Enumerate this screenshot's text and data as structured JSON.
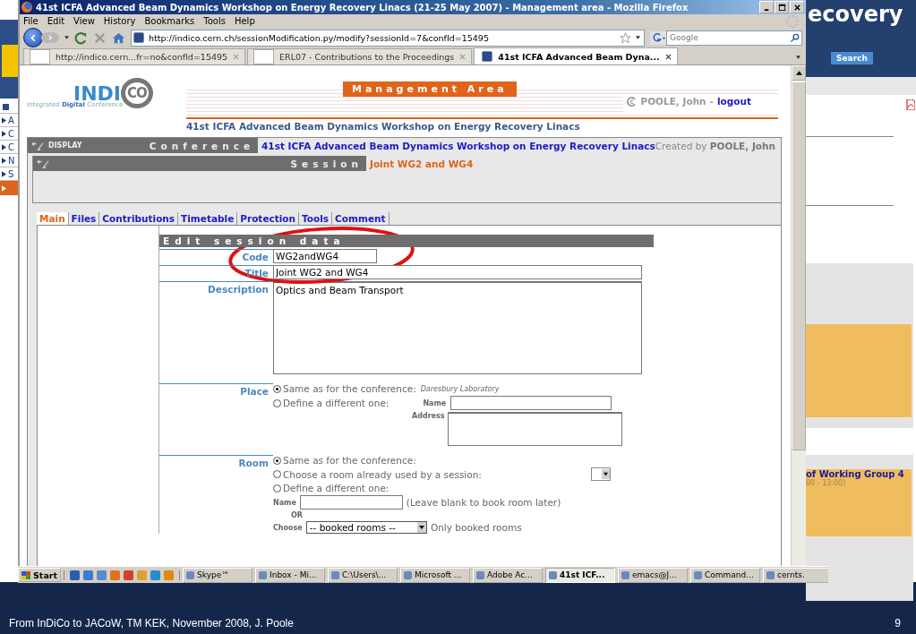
{
  "slide": {
    "footer": "From InDiCo to JACoW, TM KEK, November 2008, J. Poole",
    "page_number": "9"
  },
  "left_fragment": {
    "items": [
      {
        "label": "A",
        "selected": false
      },
      {
        "label": "C",
        "selected": false
      },
      {
        "label": "C",
        "selected": false
      },
      {
        "label": "N",
        "selected": false
      },
      {
        "label": "S",
        "selected": false
      },
      {
        "selected": true
      }
    ]
  },
  "background_window": {
    "heading": "ecovery",
    "search_button": "Search",
    "event_title": "of Working Group 4",
    "event_time": "00 - 13:00)"
  },
  "browser": {
    "title": "41st ICFA Advanced Beam Dynamics Workshop on Energy Recovery Linacs (21-25 May 2007) - Management area - Mozilla Firefox",
    "menu": [
      "File",
      "Edit",
      "View",
      "History",
      "Bookmarks",
      "Tools",
      "Help"
    ],
    "url": "http://indico.cern.ch/sessionModification.py/modify?sessionId=7&confId=15495",
    "search_placeholder": "Google",
    "tabs": [
      {
        "label": "http://indico.cern...fr=no&confId=15495",
        "selected": false
      },
      {
        "label": "ERL07 - Contributions to the Proceedings",
        "selected": false
      },
      {
        "label": "41st ICFA Advanced Beam Dyna...",
        "selected": true
      }
    ]
  },
  "page": {
    "logo": {
      "name": "INDI",
      "ring": "CO",
      "tagline": "Integrated **Digital** Conference"
    },
    "management_area": "Management Area",
    "user": {
      "name": "POOLE, John",
      "separator": "-",
      "logout": "logout"
    },
    "conference_title": "41st ICFA Advanced Beam Dynamics Workshop on Energy Recovery Linacs",
    "display_bar": {
      "display_label": "DISPLAY",
      "conference_label": "Conference",
      "conference_link": "41st ICFA Advanced Beam Dynamics Workshop on Energy Recovery Linacs",
      "created_by": "Created by **POOLE, John**"
    },
    "session_bar": {
      "label": "Session",
      "title": "Joint WG2 and WG4"
    },
    "section_tabs": [
      {
        "label": "Main",
        "selected": true
      },
      {
        "label": "Files",
        "selected": false
      },
      {
        "label": "Contributions",
        "selected": false
      },
      {
        "label": "Timetable",
        "selected": false
      },
      {
        "label": "Protection",
        "selected": false
      },
      {
        "label": "Tools",
        "selected": false
      },
      {
        "label": "Comment",
        "selected": false
      }
    ],
    "form": {
      "heading": "Edit session data",
      "code": {
        "label": "Code",
        "value": "WG2andWG4"
      },
      "title": {
        "label": "Title",
        "value": "Joint WG2 and WG4"
      },
      "description": {
        "label": "Description",
        "value": "Optics and Beam Transport"
      },
      "place": {
        "label": "Place",
        "options": [
          {
            "label": "Same as for the conference:",
            "note": "Daresbury Laboratory",
            "selected": true
          },
          {
            "label": "Define a different one:",
            "selected": false
          }
        ],
        "name_label": "Name",
        "address_label": "Address"
      },
      "room": {
        "label": "Room",
        "options": [
          {
            "label": "Same as for the conference:",
            "selected": true
          },
          {
            "label": "Choose a room already used by a session:",
            "selected": false
          },
          {
            "label": "Define a different one:",
            "selected": false
          }
        ],
        "name_label": "Name",
        "name_hint": "(Leave blank to book room later)",
        "or": "OR",
        "choose_label": "Choose",
        "booked_select": "-- booked rooms --",
        "only_booked": "Only booked rooms"
      }
    }
  },
  "taskbar": {
    "start": "Start",
    "tasks": [
      {
        "label": "Skype™",
        "selected": false
      },
      {
        "label": "Inbox - Mi...",
        "selected": false
      },
      {
        "label": "C:\\Users\\...",
        "selected": false
      },
      {
        "label": "Microsoft ...",
        "selected": false
      },
      {
        "label": "Adobe Ac...",
        "selected": false
      },
      {
        "label": "41st ICF...",
        "selected": true
      },
      {
        "label": "emacs@J...",
        "selected": false
      },
      {
        "label": "Command...",
        "selected": false
      },
      {
        "label": "cernts.",
        "selected": false
      }
    ]
  }
}
